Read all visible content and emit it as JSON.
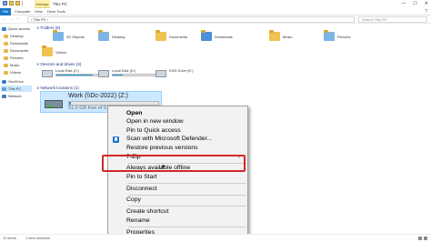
{
  "window": {
    "manage_tab": "Manage",
    "title": "This PC",
    "controls": [
      "—",
      "☐",
      "✕"
    ]
  },
  "ribbon": {
    "tabs": [
      "File",
      "Computer",
      "View",
      "Drive Tools"
    ],
    "help": "?"
  },
  "address": {
    "path": "› This PC ›",
    "search_placeholder": "Search This PC"
  },
  "nav": {
    "items": [
      {
        "label": "Quick access",
        "icon": "star-icon"
      },
      {
        "label": "Desktop",
        "icon": "folder-icon"
      },
      {
        "label": "Downloads",
        "icon": "folder-icon"
      },
      {
        "label": "Documents",
        "icon": "folder-icon"
      },
      {
        "label": "Pictures",
        "icon": "folder-icon"
      },
      {
        "label": "Music",
        "icon": "folder-icon"
      },
      {
        "label": "Videos",
        "icon": "folder-icon"
      },
      {
        "label": "OneDrive",
        "icon": "cloud-icon"
      },
      {
        "label": "This PC",
        "icon": "pc-icon"
      },
      {
        "label": "Network",
        "icon": "network-icon"
      }
    ]
  },
  "sections": {
    "folders": "∨ Folders (6)",
    "devices": "∨ Devices and drives (3)",
    "network": "∨ Network locations (1)"
  },
  "folders": [
    {
      "label": "3D Objects"
    },
    {
      "label": "Desktop"
    },
    {
      "label": "Documents"
    },
    {
      "label": "Downloads"
    },
    {
      "label": "Music"
    },
    {
      "label": "Pictures"
    },
    {
      "label": "Videos"
    }
  ],
  "drives": [
    {
      "label": "Local Disk (C:)",
      "free": "",
      "fill": 0.75
    },
    {
      "label": "Local Disk (D:)",
      "free": "",
      "fill": 0.2
    },
    {
      "label": "DVD Drive (E:)",
      "free": "",
      "fill": 0
    }
  ],
  "network_drive": {
    "name": "Work (\\\\Dc-2022) (Z:)",
    "free": "51.0 GB free of 51.0 GB",
    "fill": 0.02
  },
  "context_menu": {
    "items": [
      "Open",
      "Open in new window",
      "Pin to Quick access",
      "Scan with Microsoft Defender...",
      "Restore previous versions",
      "7-Zip",
      "Always available offline",
      "Pin to Start",
      "Disconnect",
      "Copy",
      "Create shortcut",
      "Rename",
      "Properties"
    ],
    "submenu_arrow": "›"
  },
  "status": {
    "items": "11 items",
    "selected": "1 item selected"
  },
  "colors": {
    "selection": "#cce8ff",
    "highlight_box": "#d32828",
    "accent": "#1979ca"
  }
}
